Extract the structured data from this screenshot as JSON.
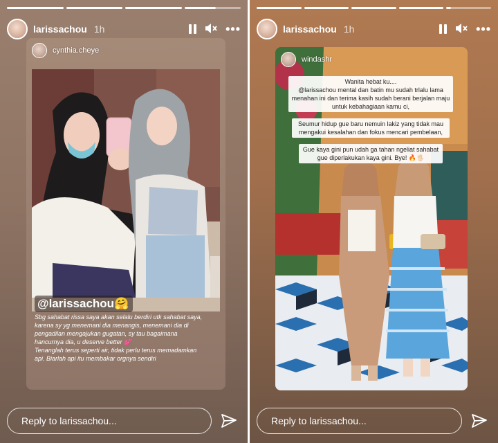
{
  "left_story": {
    "progress_segments": [
      1,
      1,
      1,
      0.55
    ],
    "username": "larissachou",
    "timestamp": "1h",
    "reshared_from": "cynthia.cheye",
    "mention_tag": "@larissachou🤗",
    "caption_lines": [
      "Sbg sahabat rissa saya akan selalu berdiri utk sahabat saya,",
      "karena sy yg menemani dia menangis, menemani dia di",
      "pengadilan mengajukan gugatan, sy tau bagaimana",
      "hancurnya dia, u deserve better 💕",
      "Tenanglah terus seperti air, tidak perlu terus memadamkan",
      "api. Biarlah api itu membakar orgnya sendiri"
    ],
    "reply_placeholder": "Reply to larissachou..."
  },
  "right_story": {
    "progress_segments": [
      1,
      1,
      1,
      1,
      0.1
    ],
    "username": "larissachou",
    "timestamp": "1h",
    "reshared_from": "windashr",
    "text_boxes": [
      "Wanita hebat ku....\n@larissachou mental dan batin mu sudah trlalu lama menahan ini dan terima kasih sudah berani berjalan maju untuk kebahagiaan kamu ci,",
      "Seumur hidup gue baru nemuin lakiz yang tidak mau mengakui kesalahan dan fokus mencari pembelaan,",
      "Gue kaya gini pun udah ga tahan ngeliat sahabat gue diperlakukan kaya gini. Bye! 🔥🖐🏻"
    ],
    "reply_placeholder": "Reply to larissachou..."
  },
  "icons": {
    "pause": "pause-icon",
    "mute": "mute-icon",
    "more": "more-icon",
    "send": "send-icon"
  },
  "colors": {
    "accent": "#ffffff",
    "tag_bg": "#3a2c25"
  }
}
